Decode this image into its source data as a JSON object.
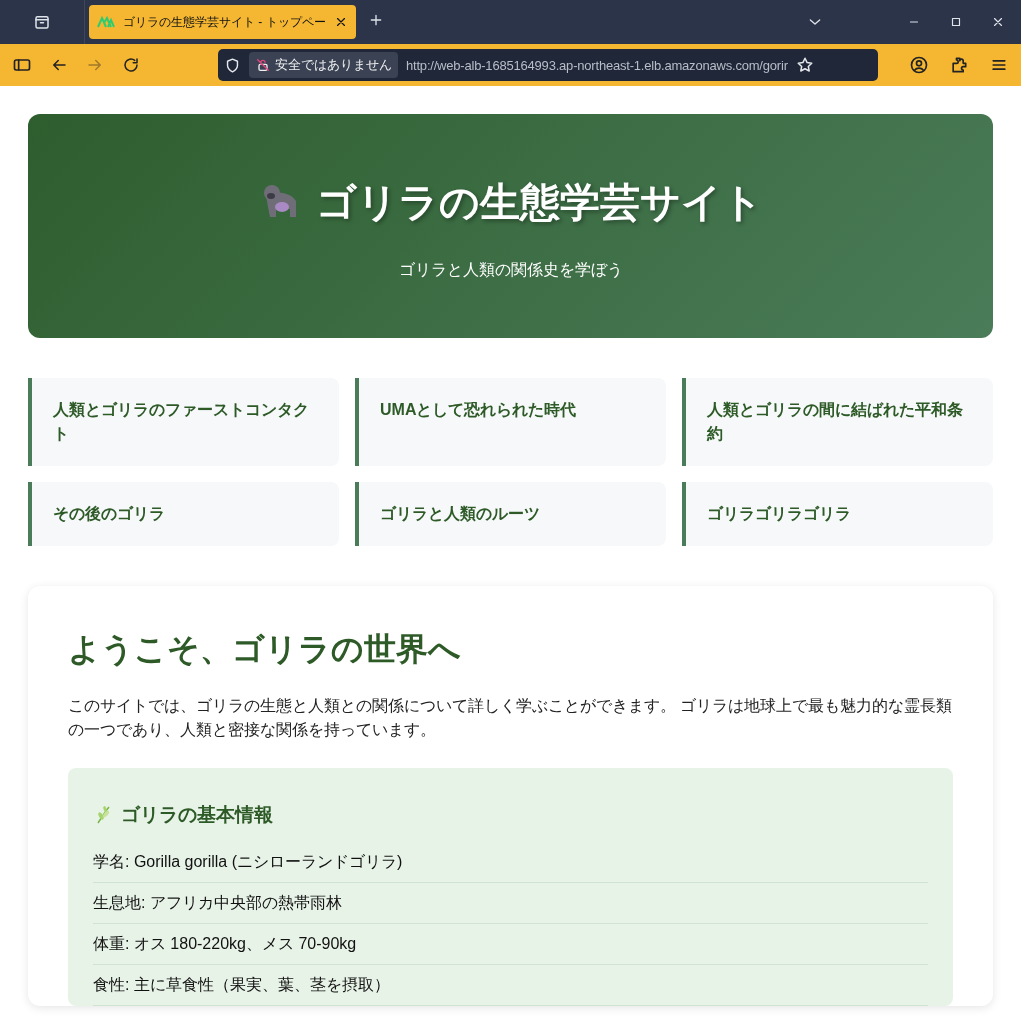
{
  "browser": {
    "tabs": [
      {
        "title": "ゴリラの生態学芸サイト - トップペー",
        "selected": true
      }
    ],
    "forward": {
      "disabled": true
    },
    "address": {
      "security_label": "安全ではありません",
      "url": "http://web-alb-1685164993.ap-northeast-1.elb.amazonaws.com/gorir"
    }
  },
  "header": {
    "title": "ゴリラの生態学芸サイト",
    "subtitle": "ゴリラと人類の関係史を学ぼう"
  },
  "nav": [
    {
      "label": "人類とゴリラのファーストコンタクト"
    },
    {
      "label": "UMAとして恐れられた時代"
    },
    {
      "label": "人類とゴリラの間に結ばれた平和条約"
    },
    {
      "label": "その後のゴリラ"
    },
    {
      "label": "ゴリラと人類のルーツ"
    },
    {
      "label": "ゴリラゴリラゴリラ"
    }
  ],
  "welcome": {
    "heading": "ようこそ、ゴリラの世界へ",
    "text": "このサイトでは、ゴリラの生態と人類との関係について詳しく学ぶことができます。 ゴリラは地球上で最も魅力的な霊長類の一つであり、人類と密接な関係を持っています。"
  },
  "info": {
    "heading": "ゴリラの基本情報",
    "items": [
      "学名: Gorilla gorilla (ニシローランドゴリラ)",
      "生息地: アフリカ中央部の熱帯雨林",
      "体重: オス 180-220kg、メス 70-90kg",
      "食性: 主に草食性（果実、葉、茎を摂取）"
    ]
  }
}
